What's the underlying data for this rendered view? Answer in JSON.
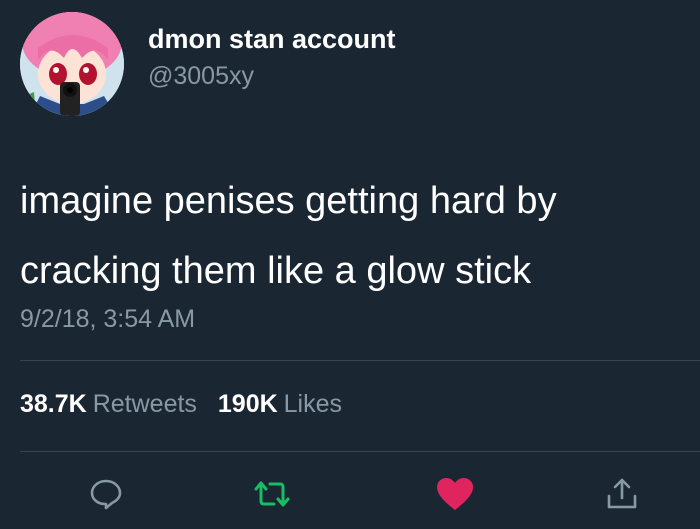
{
  "author": {
    "name": "dmon stan account",
    "handle": "@3005xy"
  },
  "tweet": {
    "text_lines": [
      "imagine penises getting hard by",
      "cracking them like a glow stick"
    ],
    "timestamp": "9/2/18, 3:54 AM"
  },
  "stats": {
    "retweets_count": "38.7K",
    "retweets_label": "Retweets",
    "likes_count": "190K",
    "likes_label": "Likes"
  },
  "actions": {
    "reply_icon": "speech-bubble-icon",
    "retweet_icon": "retweet-arrows-icon",
    "like_icon": "heart-icon",
    "share_icon": "share-arrow-icon",
    "liked": true
  },
  "colors": {
    "background": "#1b2633",
    "secondary_text": "#8899a6",
    "divider": "#38444d",
    "retweet_green": "#17bf63",
    "like_red": "#e0245e",
    "icon_gray": "#8899a6"
  }
}
